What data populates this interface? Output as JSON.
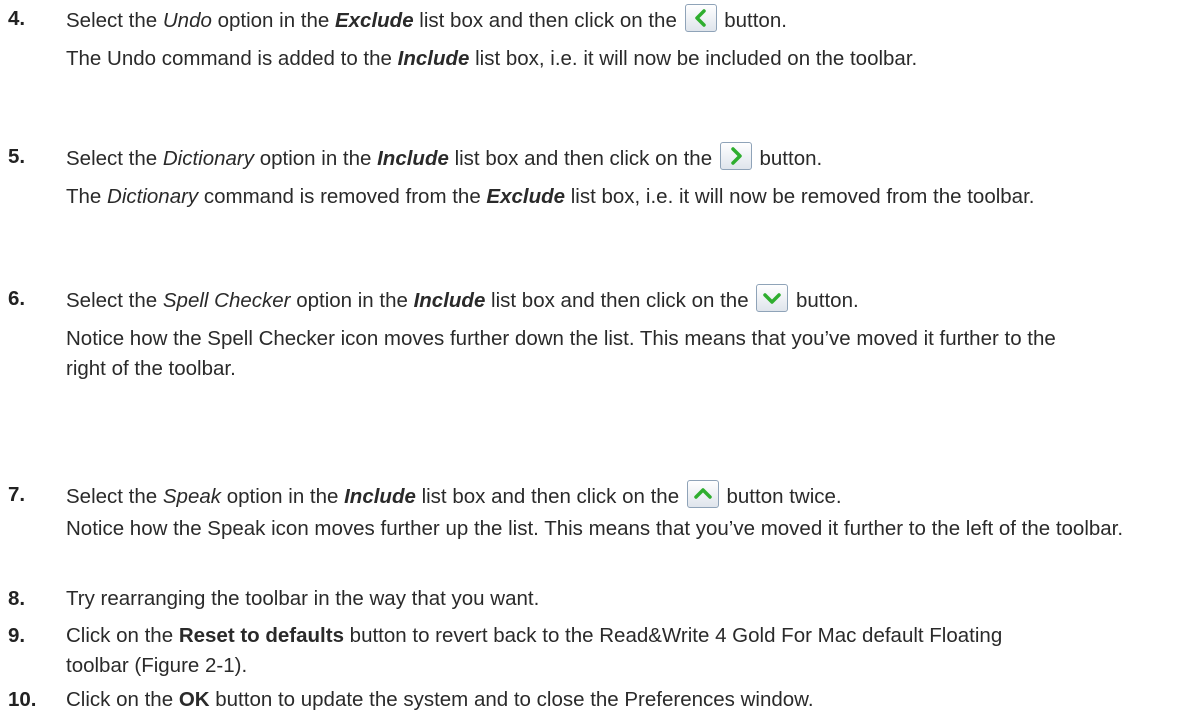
{
  "steps": [
    {
      "number": "4.",
      "line1_a": "Select the ",
      "line1_b": "Undo",
      "line1_c": " option in the ",
      "line1_d": "Exclude",
      "line1_e": " list box and then click on the ",
      "button_icon": "arrow-left-icon",
      "line1_f": " button.",
      "para2_a": "The Undo command is added to the ",
      "para2_b": "Include",
      "para2_c": " list box, i.e. it will now be included on the toolbar."
    },
    {
      "number": "5.",
      "line1_a": "Select the ",
      "line1_b": "Dictionary",
      "line1_c": " option in the ",
      "line1_d": "Include",
      "line1_e": " list box and then click on the ",
      "button_icon": "arrow-right-icon",
      "line1_f": " button.",
      "para2_a": "The ",
      "para2_b": "Dictionary",
      "para2_c": " command is removed from the ",
      "para2_d": "Exclude",
      "para2_e": " list box, i.e. it will now be removed from the toolbar."
    },
    {
      "number": "6.",
      "line1_a": "Select the ",
      "line1_b": "Spell Checker",
      "line1_c": " option in the ",
      "line1_d": "Include",
      "line1_e": " list box and then click on the ",
      "button_icon": "arrow-down-icon",
      "line1_f": " button.",
      "para2": "Notice how the Spell Checker icon moves further down the list. This means that you’ve moved it further to the right of the toolbar."
    },
    {
      "number": "7.",
      "line1_a": "Select the ",
      "line1_b": "Speak",
      "line1_c": " option in the ",
      "line1_d": "Include",
      "line1_e": " list box and then click on the ",
      "button_icon": "arrow-up-icon",
      "line1_f": " button twice.",
      "para2": "Notice how the Speak icon moves further up the list. This means that you’ve moved it further to the left of the toolbar."
    },
    {
      "number": "8.",
      "text": "Try rearranging the toolbar in the way that you want."
    },
    {
      "number": "9.",
      "text_a": "Click on the ",
      "text_b": "Reset to defaults",
      "text_c": " button to revert back to the Read&Write 4 Gold For Mac default Floating toolbar (Figure 2-1)."
    },
    {
      "number": "10.",
      "text_a": "Click on the ",
      "text_b": "OK",
      "text_c": " button to update the system and to close the Preferences window."
    }
  ],
  "colors": {
    "text": "#2a2a2a",
    "arrow_green": "#2fae2f",
    "button_border": "#8fa3b8"
  }
}
